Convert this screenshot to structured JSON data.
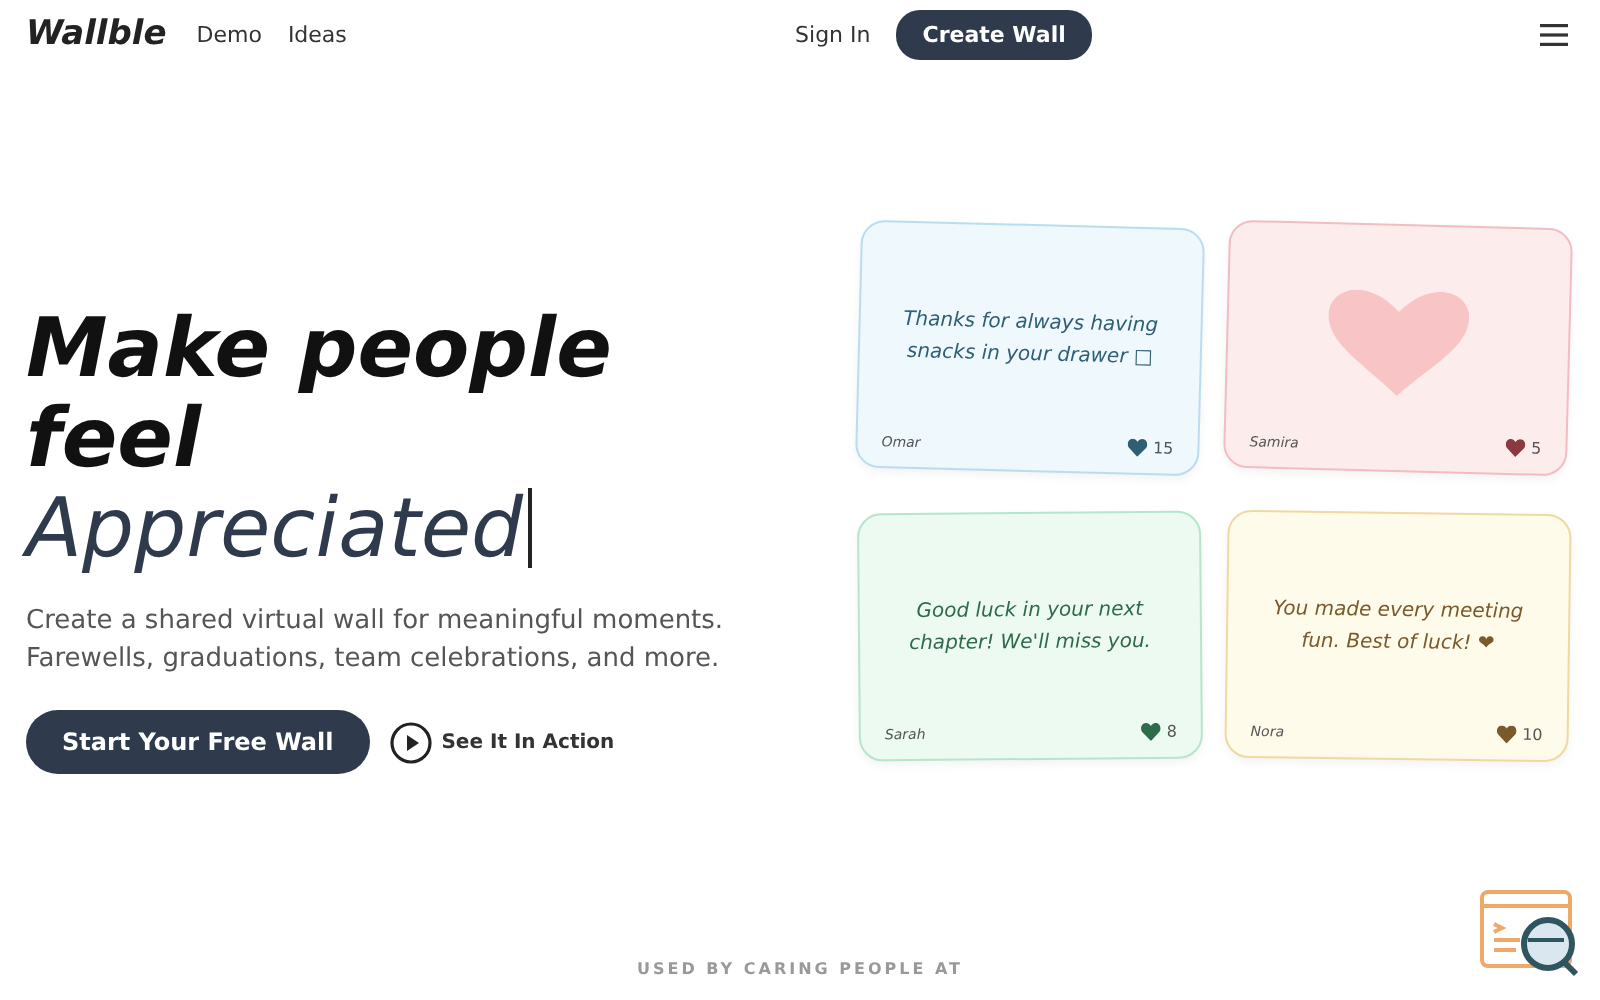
{
  "nav": {
    "logo": "Wallble",
    "links": [
      "Demo",
      "Ideas"
    ],
    "sign_in": "Sign In",
    "cta": "Create Wall"
  },
  "hero": {
    "title_start": "Make people feel",
    "title_highlight": "Appreciated",
    "subtitle": "Create a shared virtual wall for meaningful moments. Farewells, graduations, team celebrations, and more.",
    "primary": "Start Your Free Wall",
    "secondary": "See It In Action"
  },
  "cards": [
    {
      "kind": "text",
      "message": "Thanks for always having snacks in your drawer □",
      "author": "Omar",
      "likes": "15",
      "color": "#2f5f73"
    },
    {
      "kind": "heart",
      "author": "Samira",
      "likes": "5",
      "color": "#8a3a3e"
    },
    {
      "kind": "text",
      "message": "Good luck in your next chapter! We'll miss you.",
      "author": "Sarah",
      "likes": "8",
      "color": "#2f6a4a"
    },
    {
      "kind": "text",
      "message": "You made every meeting fun. Best of luck! ❤",
      "author": "Nora",
      "likes": "10",
      "color": "#7a5a2a"
    }
  ],
  "footer": {
    "caption": "USED BY CARING PEOPLE AT"
  }
}
